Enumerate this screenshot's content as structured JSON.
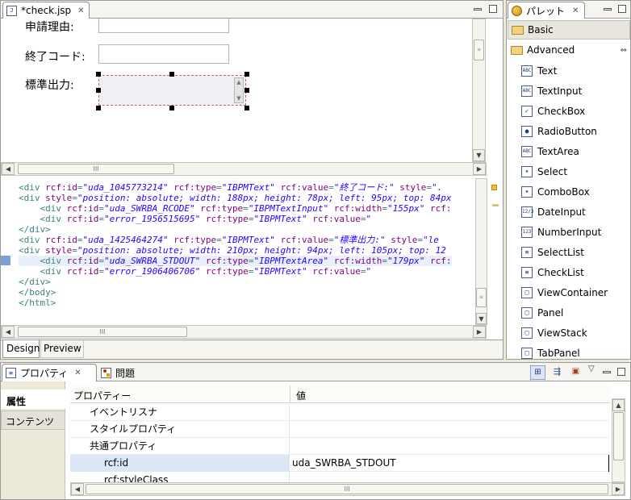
{
  "editor": {
    "tab_title": "*check.jsp",
    "design": {
      "label_reason": "申請理由:",
      "label_end_code": "終了コード:",
      "label_stdout": "標準出力:"
    },
    "code_lines": [
      [
        [
          "t",
          "<div "
        ],
        [
          "a",
          "rcf:id"
        ],
        [
          "t",
          "="
        ],
        [
          "v",
          "\"uda_1045773214\""
        ],
        [
          "t",
          " "
        ],
        [
          "a",
          "rcf:type"
        ],
        [
          "t",
          "="
        ],
        [
          "v",
          "\"IBPMText\""
        ],
        [
          "t",
          " "
        ],
        [
          "a",
          "rcf:value"
        ],
        [
          "t",
          "="
        ],
        [
          "v",
          "\"終了コード:\""
        ],
        [
          "t",
          " "
        ],
        [
          "a",
          "style"
        ],
        [
          "t",
          "="
        ],
        [
          "v",
          "\"."
        ]
      ],
      [
        [
          "t",
          "<div "
        ],
        [
          "a",
          "style"
        ],
        [
          "t",
          "="
        ],
        [
          "v",
          "\"position: absolute; width: 188px; height: 78px; left: 95px; top: 84px"
        ]
      ],
      [
        [
          "t",
          "    <div "
        ],
        [
          "a",
          "rcf:id"
        ],
        [
          "t",
          "="
        ],
        [
          "v",
          "\"uda_SWRBA_RCODE\""
        ],
        [
          "t",
          " "
        ],
        [
          "a",
          "rcf:type"
        ],
        [
          "t",
          "="
        ],
        [
          "v",
          "\"IBPMTextInput\""
        ],
        [
          "t",
          " "
        ],
        [
          "a",
          "rcf:width"
        ],
        [
          "t",
          "="
        ],
        [
          "v",
          "\"155px\""
        ],
        [
          "t",
          " "
        ],
        [
          "a",
          "rcf:"
        ]
      ],
      [
        [
          "t",
          "    <div "
        ],
        [
          "a",
          "rcf:id"
        ],
        [
          "t",
          "="
        ],
        [
          "v",
          "\"error_1956515695\""
        ],
        [
          "t",
          " "
        ],
        [
          "a",
          "rcf:type"
        ],
        [
          "t",
          "="
        ],
        [
          "v",
          "\"IBPMText\""
        ],
        [
          "t",
          " "
        ],
        [
          "a",
          "rcf:value"
        ],
        [
          "t",
          "="
        ],
        [
          "v",
          "\""
        ]
      ],
      [
        [
          "t",
          "</div>"
        ]
      ],
      [
        [
          "t",
          "<div "
        ],
        [
          "a",
          "rcf:id"
        ],
        [
          "t",
          "="
        ],
        [
          "v",
          "\"uda_1425464274\""
        ],
        [
          "t",
          " "
        ],
        [
          "a",
          "rcf:type"
        ],
        [
          "t",
          "="
        ],
        [
          "v",
          "\"IBPMText\""
        ],
        [
          "t",
          " "
        ],
        [
          "a",
          "rcf:value"
        ],
        [
          "t",
          "="
        ],
        [
          "v",
          "\"標準出力:\""
        ],
        [
          "t",
          " "
        ],
        [
          "a",
          "style"
        ],
        [
          "t",
          "="
        ],
        [
          "v",
          "\"le"
        ]
      ],
      [
        [
          "t",
          "<div "
        ],
        [
          "a",
          "style"
        ],
        [
          "t",
          "="
        ],
        [
          "v",
          "\"position: absolute; width: 210px; height: 94px; left: 105px; top: 12"
        ]
      ],
      [
        [
          "t",
          "    <div "
        ],
        [
          "a",
          "rcf:id"
        ],
        [
          "t",
          "="
        ],
        [
          "v",
          "\"uda_SWRBA_STDOUT\""
        ],
        [
          "t",
          " "
        ],
        [
          "a",
          "rcf:type"
        ],
        [
          "t",
          "="
        ],
        [
          "v",
          "\"IBPMTextArea\""
        ],
        [
          "t",
          " "
        ],
        [
          "a",
          "rcf:width"
        ],
        [
          "t",
          "="
        ],
        [
          "v",
          "\"179px\""
        ],
        [
          "t",
          " "
        ],
        [
          "a",
          "rcf:"
        ]
      ],
      [
        [
          "t",
          "    <div "
        ],
        [
          "a",
          "rcf:id"
        ],
        [
          "t",
          "="
        ],
        [
          "v",
          "\"error_1906406706\""
        ],
        [
          "t",
          " "
        ],
        [
          "a",
          "rcf:type"
        ],
        [
          "t",
          "="
        ],
        [
          "v",
          "\"IBPMText\""
        ],
        [
          "t",
          " "
        ],
        [
          "a",
          "rcf:value"
        ],
        [
          "t",
          "="
        ],
        [
          "v",
          "\""
        ]
      ],
      [
        [
          "t",
          "</div>"
        ]
      ],
      [
        [
          "t",
          "</body>"
        ]
      ],
      [
        [
          "t",
          "</html>"
        ]
      ]
    ],
    "bottom_tabs": [
      "Design",
      "Preview"
    ],
    "scroll_grip": "III"
  },
  "palette": {
    "tab_title": "パレット",
    "drawers": [
      {
        "label": "Basic",
        "icon": "folder-icon"
      },
      {
        "label": "Advanced",
        "icon": "folder-icon"
      }
    ],
    "items": [
      {
        "label": "Text",
        "icon": "ABC"
      },
      {
        "label": "TextInput",
        "icon": "ABC"
      },
      {
        "label": "CheckBox",
        "icon": "✓"
      },
      {
        "label": "RadioButton",
        "icon": "●"
      },
      {
        "label": "TextArea",
        "icon": "ABC"
      },
      {
        "label": "Select",
        "icon": "▾"
      },
      {
        "label": "ComboBox",
        "icon": "▾"
      },
      {
        "label": "DateInput",
        "icon": "12/3"
      },
      {
        "label": "NumberInput",
        "icon": "123"
      },
      {
        "label": "SelectList",
        "icon": "≡"
      },
      {
        "label": "CheckList",
        "icon": "≡"
      },
      {
        "label": "ViewContainer",
        "icon": "□"
      },
      {
        "label": "Panel",
        "icon": "□"
      },
      {
        "label": "ViewStack",
        "icon": "□"
      },
      {
        "label": "TabPanel",
        "icon": "□"
      }
    ]
  },
  "properties": {
    "tab_title": "プロパティ",
    "problems_tab": "問題",
    "side_tabs": [
      "属性",
      "コンテンツ"
    ],
    "columns": [
      "プロパティー",
      "値"
    ],
    "rows": [
      {
        "name": "イベントリスナ",
        "value": "",
        "indent": 1
      },
      {
        "name": "スタイルプロパティ",
        "value": "",
        "indent": 1
      },
      {
        "name": "共通プロパティ",
        "value": "",
        "indent": 1
      },
      {
        "name": "rcf:id",
        "value": "uda_SWRBA_STDOUT",
        "indent": 2,
        "selected": true
      },
      {
        "name": "rcf:styleClass",
        "value": "",
        "indent": 2
      }
    ]
  },
  "colors": {
    "selection": "#dbe6f7",
    "accent": "#316ac5"
  }
}
